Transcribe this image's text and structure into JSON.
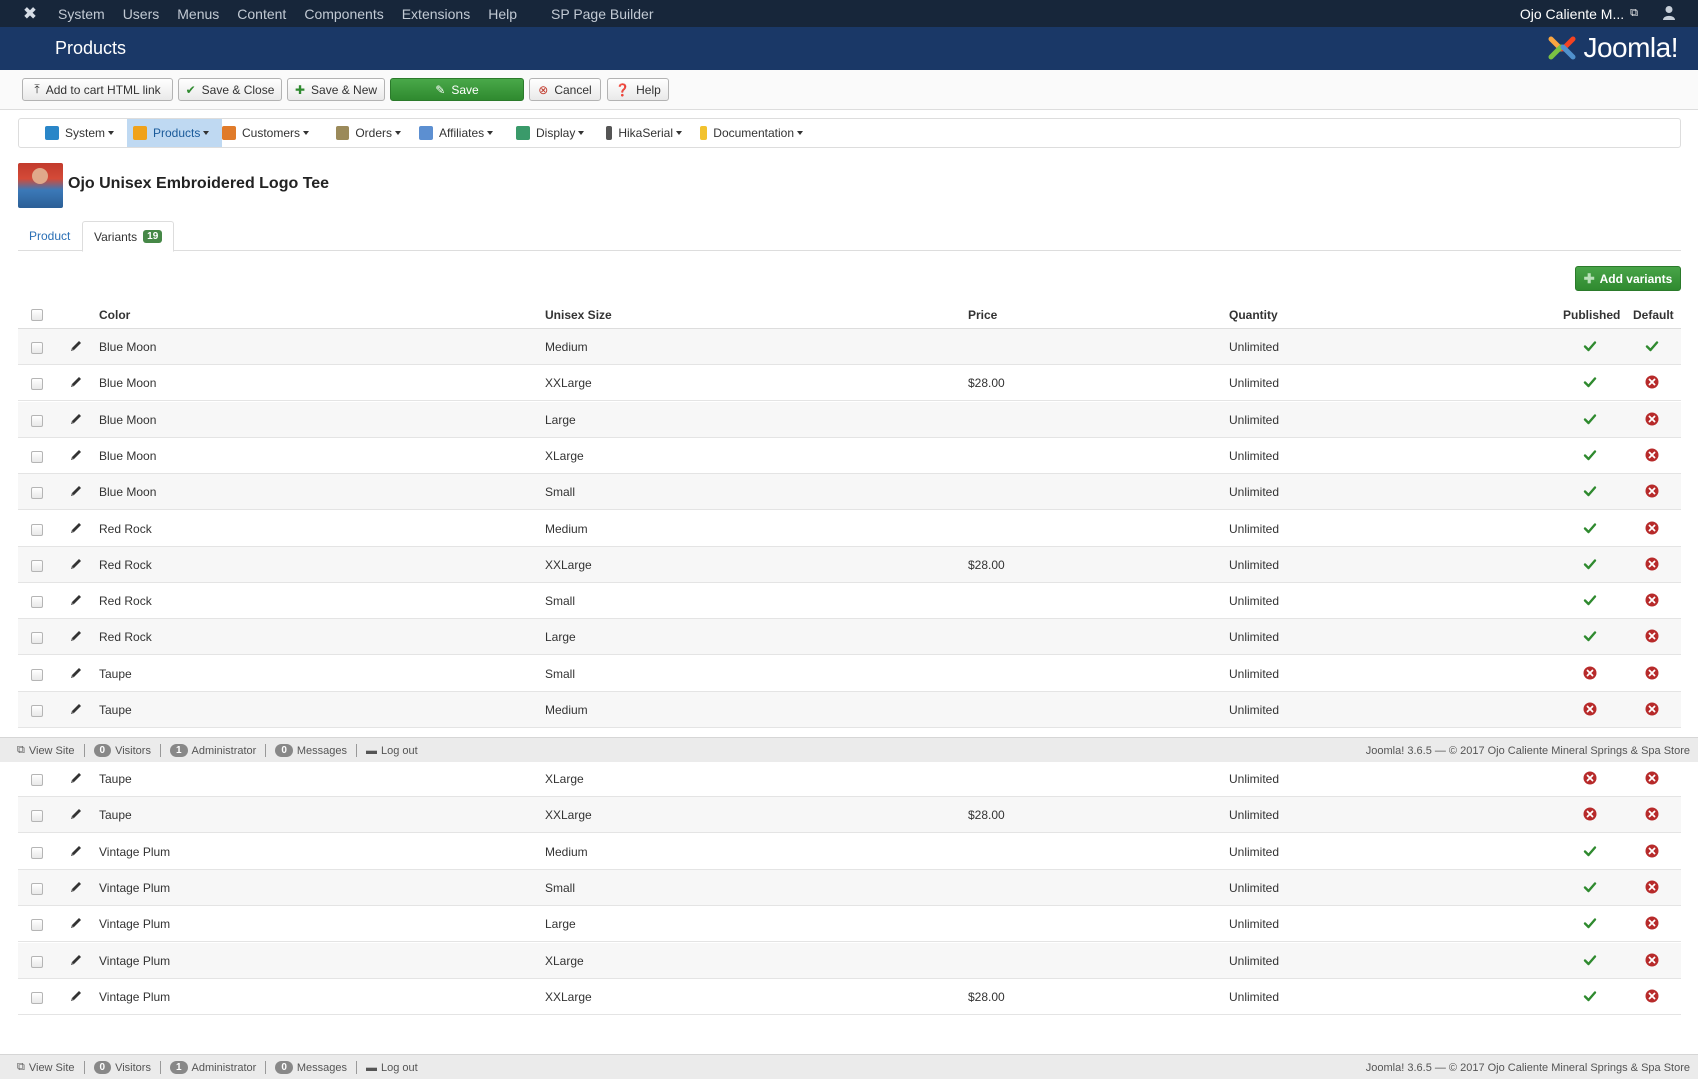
{
  "topbar": {
    "menu": [
      "System",
      "Users",
      "Menus",
      "Content",
      "Components",
      "Extensions",
      "Help"
    ],
    "extra_menu": "SP Page Builder",
    "user": "Ojo Caliente M...",
    "logo_icon": "joomla-logo-icon",
    "user_icon": "user-icon"
  },
  "title": {
    "text": "Products",
    "brand": "Joomla!"
  },
  "toolbar": {
    "addcart": "Add to cart HTML link",
    "save_close": "Save & Close",
    "save_new": "Save & New",
    "save": "Save",
    "cancel": "Cancel",
    "help": "Help"
  },
  "submenu": [
    {
      "label": "System",
      "icon": "#2a86c8"
    },
    {
      "label": "Products",
      "icon": "#f0a21b"
    },
    {
      "label": "Customers",
      "icon": "#e07b2a"
    },
    {
      "label": "Orders",
      "icon": "#9b8a5a"
    },
    {
      "label": "Affiliates",
      "icon": "#5c8fd1"
    },
    {
      "label": "Display",
      "icon": "#3a9a6a"
    },
    {
      "label": "HikaSerial",
      "icon": "#555"
    },
    {
      "label": "Documentation",
      "icon": "#f2c22e"
    }
  ],
  "product": {
    "title": "Ojo Unisex Embroidered Logo Tee"
  },
  "tabs": {
    "product": "Product",
    "variants": "Variants",
    "variants_count": "19"
  },
  "add_variants": "Add variants",
  "columns": {
    "color": "Color",
    "size": "Unisex Size",
    "price": "Price",
    "quantity": "Quantity",
    "published": "Published",
    "default": "Default"
  },
  "rows": [
    {
      "color": "Blue Moon",
      "size": "Medium",
      "price": "",
      "qty": "Unlimited",
      "published": true,
      "default": true
    },
    {
      "color": "Blue Moon",
      "size": "XXLarge",
      "price": "$28.00",
      "qty": "Unlimited",
      "published": true,
      "default": false
    },
    {
      "color": "Blue Moon",
      "size": "Large",
      "price": "",
      "qty": "Unlimited",
      "published": true,
      "default": false
    },
    {
      "color": "Blue Moon",
      "size": "XLarge",
      "price": "",
      "qty": "Unlimited",
      "published": true,
      "default": false
    },
    {
      "color": "Blue Moon",
      "size": "Small",
      "price": "",
      "qty": "Unlimited",
      "published": true,
      "default": false
    },
    {
      "color": "Red Rock",
      "size": "Medium",
      "price": "",
      "qty": "Unlimited",
      "published": true,
      "default": false
    },
    {
      "color": "Red Rock",
      "size": "XXLarge",
      "price": "$28.00",
      "qty": "Unlimited",
      "published": true,
      "default": false
    },
    {
      "color": "Red Rock",
      "size": "Small",
      "price": "",
      "qty": "Unlimited",
      "published": true,
      "default": false
    },
    {
      "color": "Red Rock",
      "size": "Large",
      "price": "",
      "qty": "Unlimited",
      "published": true,
      "default": false
    },
    {
      "color": "Taupe",
      "size": "Small",
      "price": "",
      "qty": "Unlimited",
      "published": false,
      "default": false
    },
    {
      "color": "Taupe",
      "size": "Medium",
      "price": "",
      "qty": "Unlimited",
      "published": false,
      "default": false
    },
    {
      "color": "Taupe",
      "size": "XLarge",
      "price": "",
      "qty": "Unlimited",
      "published": false,
      "default": false
    },
    {
      "color": "Taupe",
      "size": "XXLarge",
      "price": "$28.00",
      "qty": "Unlimited",
      "published": false,
      "default": false
    },
    {
      "color": "Vintage Plum",
      "size": "Medium",
      "price": "",
      "qty": "Unlimited",
      "published": true,
      "default": false
    },
    {
      "color": "Vintage Plum",
      "size": "Small",
      "price": "",
      "qty": "Unlimited",
      "published": true,
      "default": false
    },
    {
      "color": "Vintage Plum",
      "size": "Large",
      "price": "",
      "qty": "Unlimited",
      "published": true,
      "default": false
    },
    {
      "color": "Vintage Plum",
      "size": "XLarge",
      "price": "",
      "qty": "Unlimited",
      "published": true,
      "default": false
    },
    {
      "color": "Vintage Plum",
      "size": "XXLarge",
      "price": "$28.00",
      "qty": "Unlimited",
      "published": true,
      "default": false
    }
  ],
  "statusbar": {
    "view_site": "View Site",
    "visitors_count": "0",
    "visitors": "Visitors",
    "admin_count": "1",
    "admin": "Administrator",
    "messages_count": "0",
    "messages": "Messages",
    "logout": "Log out",
    "copyright": "Joomla! 3.6.5 — © 2017 Ojo Caliente Mineral Springs & Spa Store"
  },
  "colors": {
    "navbar": "#17263a",
    "titlebar": "#1a3867",
    "green": "#2f8a2f",
    "red": "#c0392b"
  }
}
